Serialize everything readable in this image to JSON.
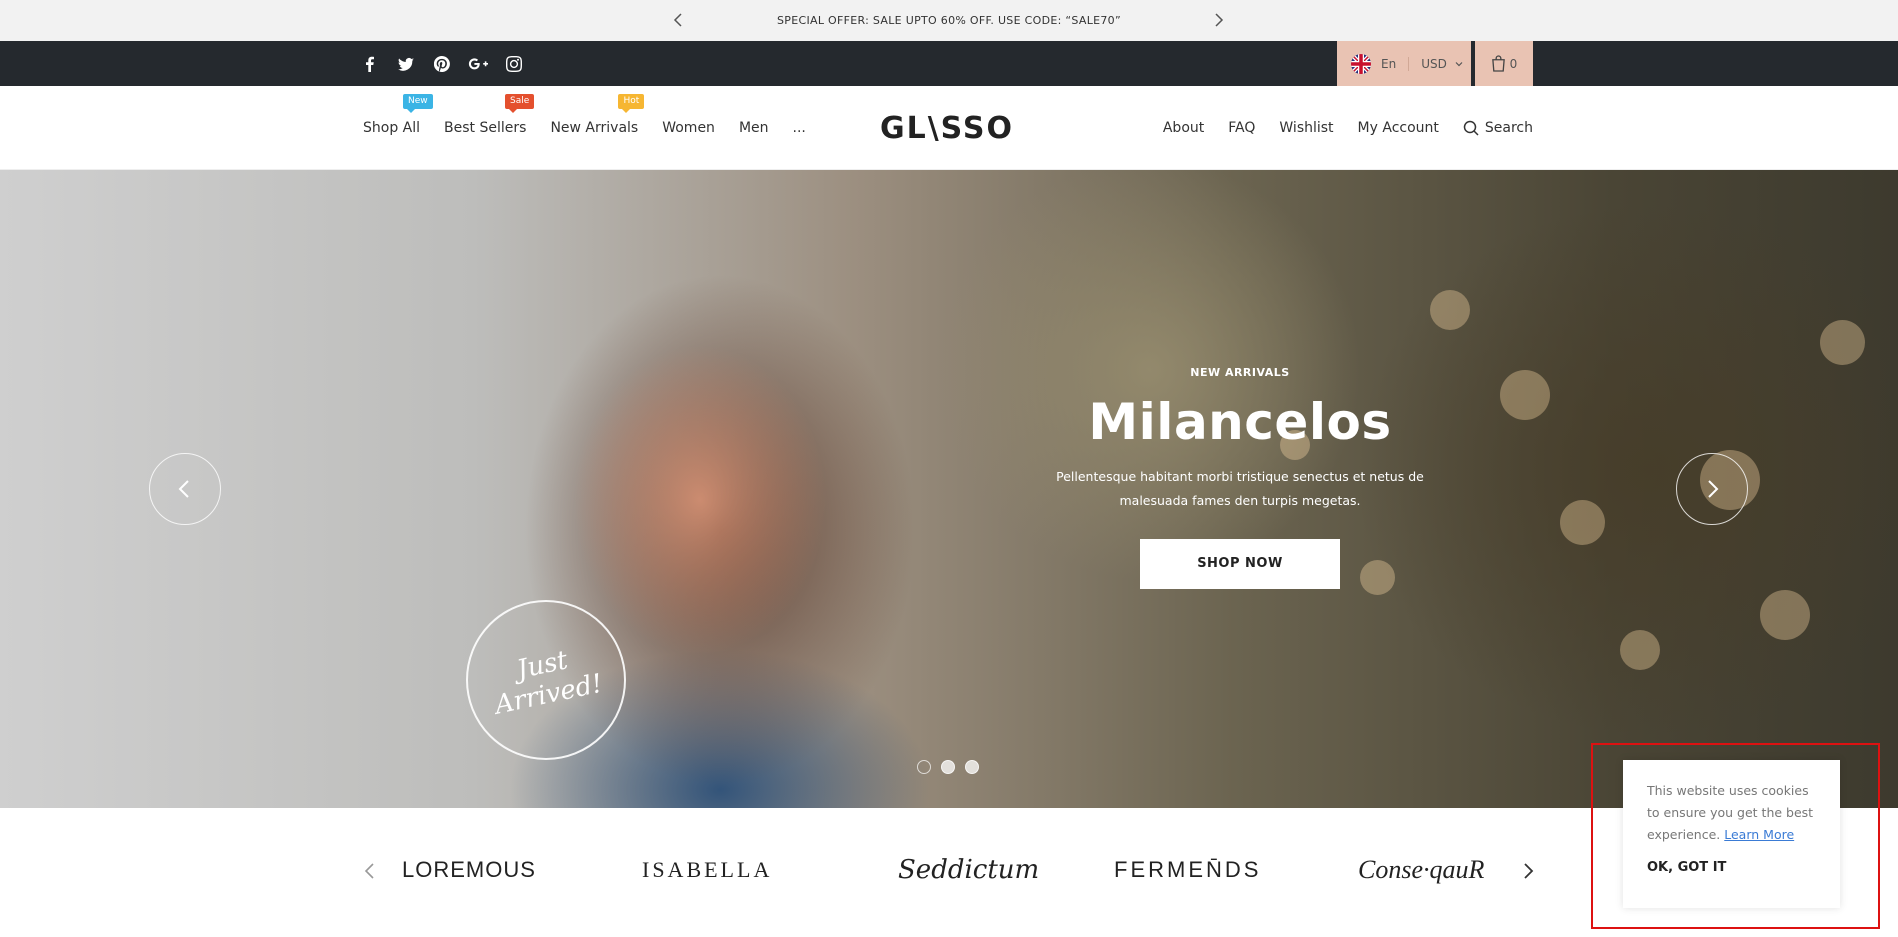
{
  "announcement": {
    "text": "SPECIAL OFFER: SALE UPTO 60% OFF. USE CODE: “SALE70”"
  },
  "topbar": {
    "social_icons": [
      "facebook-icon",
      "twitter-icon",
      "pinterest-icon",
      "google-plus-icon",
      "instagram-icon"
    ],
    "language": "En",
    "currency": "USD",
    "cart_count": "0",
    "accent_color": "#e9c3b3",
    "bar_color": "#25292e"
  },
  "header": {
    "logo": "GL\\SSO",
    "nav_left": [
      {
        "label": "Shop All",
        "badge": "New",
        "badge_color": "#3bb4e5"
      },
      {
        "label": "Best Sellers",
        "badge": "Sale",
        "badge_color": "#e4502e"
      },
      {
        "label": "New Arrivals",
        "badge": "Hot",
        "badge_color": "#f6b632"
      },
      {
        "label": "Women"
      },
      {
        "label": "Men"
      },
      {
        "label": "..."
      }
    ],
    "nav_right": [
      "About",
      "FAQ",
      "Wishlist",
      "My Account"
    ],
    "search_label": "Search"
  },
  "hero": {
    "kicker": "NEW ARRIVALS",
    "title": "Milancelos",
    "description_line1": "Pellentesque habitant morbi tristique senectus et netus de",
    "description_line2": "malesuada fames den turpis megetas.",
    "button": "SHOP NOW",
    "stamp_line1": "Just",
    "stamp_line2": "Arrived!"
  },
  "brands": [
    "LOREMOUS",
    "ISABELLA",
    "Seddictum",
    "FERMEN̄DS",
    "Conse·qauR"
  ],
  "cookie": {
    "message": "This website uses cookies to ensure you get the best experience.",
    "learn_more": "Learn More",
    "ok": "OK, GOT IT"
  }
}
